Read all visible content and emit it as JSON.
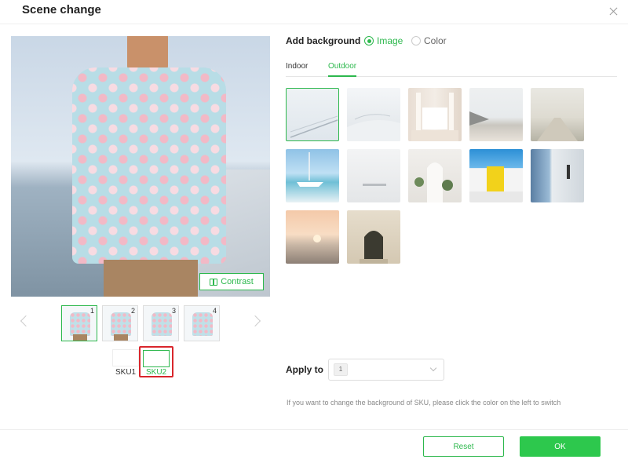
{
  "dialog": {
    "title": "Scene change"
  },
  "preview": {
    "contrast_label": "Contrast"
  },
  "thumbnails": [
    {
      "number": "1",
      "active": true
    },
    {
      "number": "2",
      "active": false
    },
    {
      "number": "3",
      "active": false
    },
    {
      "number": "4",
      "active": false
    }
  ],
  "skus": [
    {
      "label": "SKU1",
      "selected": false
    },
    {
      "label": "SKU2",
      "selected": true
    }
  ],
  "background": {
    "label": "Add background",
    "options": [
      {
        "label": "Image",
        "checked": true
      },
      {
        "label": "Color",
        "checked": false
      }
    ],
    "tabs": [
      {
        "label": "Indoor",
        "active": false
      },
      {
        "label": "Outdoor",
        "active": true
      }
    ],
    "images": [
      {
        "name": "pier-railing",
        "selected": true
      },
      {
        "name": "white-terrace",
        "selected": false
      },
      {
        "name": "colonnade-stairs",
        "selected": false
      },
      {
        "name": "beach-shore",
        "selected": false
      },
      {
        "name": "boardwalk",
        "selected": false
      },
      {
        "name": "marina-yacht",
        "selected": false
      },
      {
        "name": "misty-bench",
        "selected": false
      },
      {
        "name": "white-arch-plants",
        "selected": false
      },
      {
        "name": "yellow-door",
        "selected": false
      },
      {
        "name": "sea-window",
        "selected": false
      },
      {
        "name": "sunset-beach",
        "selected": false
      },
      {
        "name": "arched-doorway",
        "selected": false
      }
    ]
  },
  "apply": {
    "label": "Apply to",
    "value": "1"
  },
  "hint": "If you want to change the background of SKU, please click the color on the left to switch",
  "footer": {
    "reset_label": "Reset",
    "ok_label": "OK"
  },
  "colors": {
    "accent": "#2db84d",
    "ok_button": "#2dc84d",
    "sku_highlight": "#d9262c"
  }
}
